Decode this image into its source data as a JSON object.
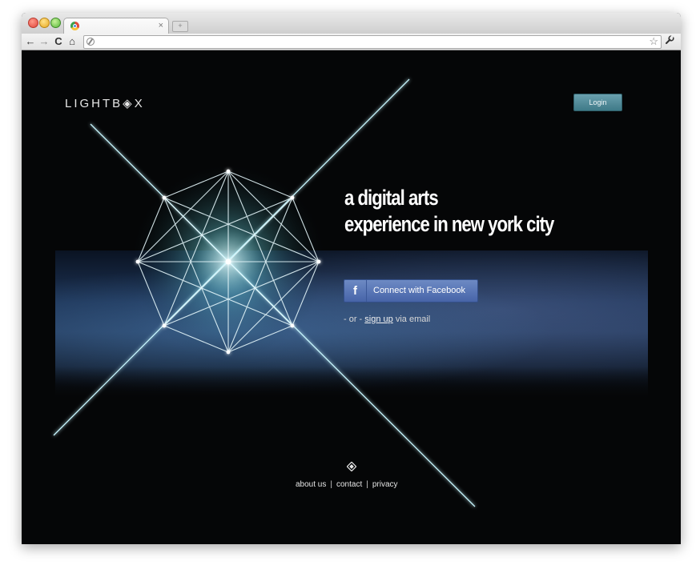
{
  "browser": {
    "tab_close": "×",
    "new_tab": "+",
    "nav": {
      "back": "←",
      "forward": "→",
      "reload": "C",
      "home": "⌂"
    },
    "star": "☆",
    "wrench": "🔧"
  },
  "site": {
    "brand": "LIGHTB◈X",
    "login_label": "Login",
    "headline_line1": "a digital arts",
    "headline_line2": "experience in new york city",
    "facebook_icon": "f",
    "facebook_label": "Connect with Facebook",
    "or_prefix": "- or -",
    "signup_link": "sign up",
    "or_suffix": "via email",
    "footer": {
      "about": "about us",
      "contact": "contact",
      "privacy": "privacy",
      "separator": "|"
    }
  },
  "colors": {
    "background": "#050607",
    "login_button": "#4f8a98",
    "facebook_button": "#5574b6",
    "light_glow": "#bff6ff"
  }
}
